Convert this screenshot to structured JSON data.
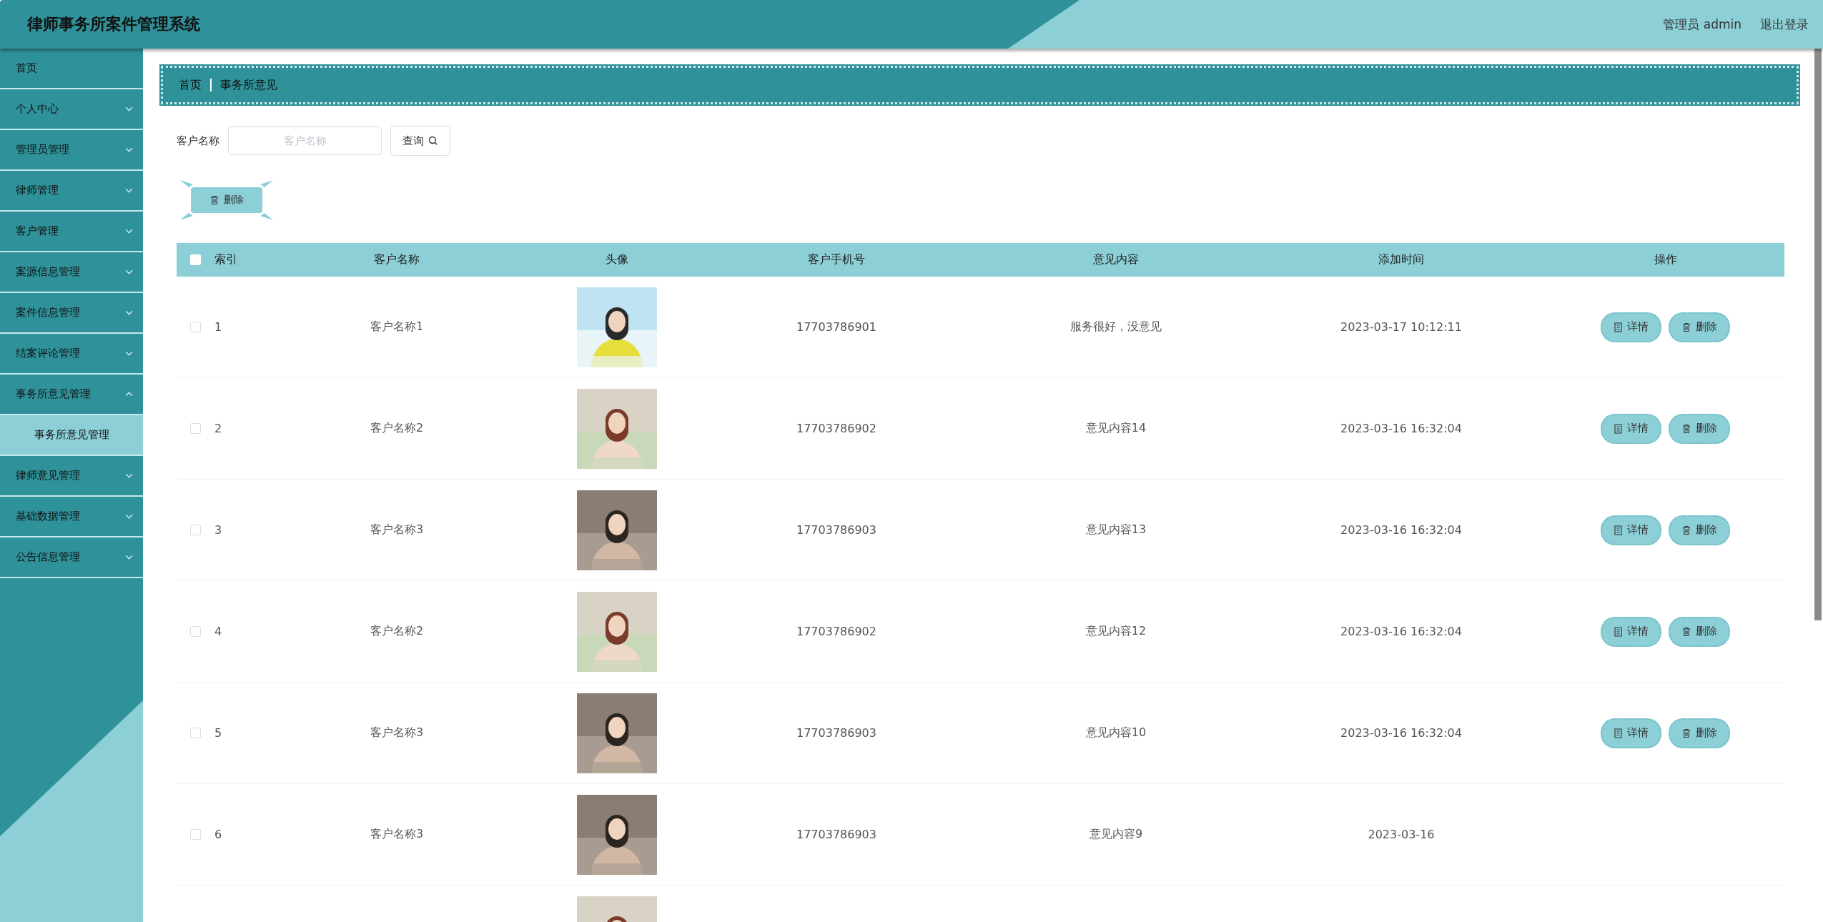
{
  "header": {
    "title": "律师事务所案件管理系统",
    "user": "管理员 admin",
    "logout": "退出登录"
  },
  "sidebar": {
    "items": [
      {
        "label": "首页",
        "expandable": false
      },
      {
        "label": "个人中心",
        "expandable": true,
        "expanded": false
      },
      {
        "label": "管理员管理",
        "expandable": true,
        "expanded": false
      },
      {
        "label": "律师管理",
        "expandable": true,
        "expanded": false
      },
      {
        "label": "客户管理",
        "expandable": true,
        "expanded": false
      },
      {
        "label": "案源信息管理",
        "expandable": true,
        "expanded": false
      },
      {
        "label": "案件信息管理",
        "expandable": true,
        "expanded": false
      },
      {
        "label": "结案评论管理",
        "expandable": true,
        "expanded": false
      },
      {
        "label": "事务所意见管理",
        "expandable": true,
        "expanded": true,
        "children": [
          {
            "label": "事务所意见管理",
            "selected": true
          }
        ]
      },
      {
        "label": "律师意见管理",
        "expandable": true,
        "expanded": false
      },
      {
        "label": "基础数据管理",
        "expandable": true,
        "expanded": false
      },
      {
        "label": "公告信息管理",
        "expandable": true,
        "expanded": false
      }
    ]
  },
  "breadcrumb": [
    "首页",
    "事务所意见"
  ],
  "search": {
    "label": "客户名称",
    "placeholder": "客户名称",
    "button": "查询"
  },
  "bulk_delete": "删除",
  "table": {
    "select_all_checked": false,
    "columns": [
      "索引",
      "客户名称",
      "头像",
      "客户手机号",
      "意见内容",
      "添加时间",
      "操作"
    ],
    "rows": [
      {
        "checked": false,
        "index": "1",
        "name": "客户名称1",
        "avatar": {
          "kind": "picture"
        },
        "phone": "17703786901",
        "content": "服务很好，没意见",
        "time": "2023-03-17 10:12:11",
        "actions": [
          "详情",
          "删除"
        ]
      },
      {
        "checked": false,
        "index": "2",
        "name": "客户名称2",
        "avatar": {
          "kind": "picture"
        },
        "phone": "17703786902",
        "content": "意见内容14",
        "time": "2023-03-16 16:32:04",
        "actions": [
          "详情",
          "删除"
        ]
      },
      {
        "checked": false,
        "index": "3",
        "name": "客户名称3",
        "avatar": {
          "kind": "picture"
        },
        "phone": "17703786903",
        "content": "意见内容13",
        "time": "2023-03-16 16:32:04",
        "actions": [
          "详情",
          "删除"
        ]
      },
      {
        "checked": false,
        "index": "4",
        "name": "客户名称2",
        "avatar": {
          "kind": "picture"
        },
        "phone": "17703786902",
        "content": "意见内容12",
        "time": "2023-03-16 16:32:04",
        "actions": [
          "详情",
          "删除"
        ]
      },
      {
        "checked": false,
        "index": "5",
        "name": "客户名称3",
        "avatar": {
          "kind": "picture"
        },
        "phone": "17703786903",
        "content": "意见内容10",
        "time": "2023-03-16 16:32:04",
        "actions": [
          "详情",
          "删除"
        ]
      },
      {
        "checked": false,
        "index": "6",
        "name": "客户名称3",
        "avatar": {
          "kind": "picture"
        },
        "phone": "17703786903",
        "content": "意见内容9",
        "time": "2023-03-16"
      },
      {
        "avatar": {
          "kind": "picture"
        }
      }
    ]
  }
}
